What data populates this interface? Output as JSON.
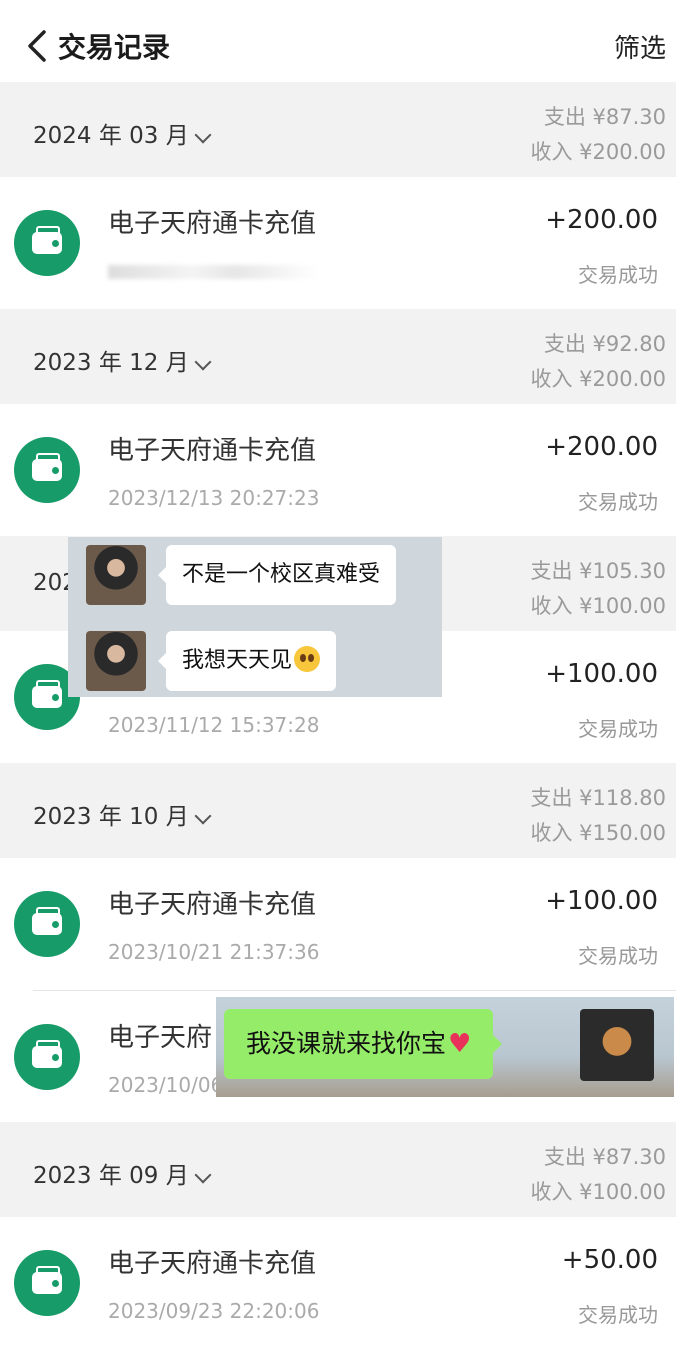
{
  "header": {
    "title": "交易记录",
    "filter_label": "筛选"
  },
  "months": [
    {
      "label": "2024 年 03 月",
      "expense": "支出  ¥87.30",
      "income": "收入  ¥200.00"
    },
    {
      "label": "2023 年 12 月",
      "expense": "支出  ¥92.80",
      "income": "收入  ¥200.00"
    },
    {
      "label": "202",
      "expense": "支出  ¥105.30",
      "income": "收入  ¥100.00"
    },
    {
      "label": "2023 年 10 月",
      "expense": "支出  ¥118.80",
      "income": "收入  ¥150.00"
    },
    {
      "label": "2023 年 09 月",
      "expense": "支出  ¥87.30",
      "income": "收入  ¥100.00"
    }
  ],
  "transactions": [
    {
      "name": "电子天府通卡充值",
      "time": "",
      "amount": "+200.00",
      "status": "交易成功"
    },
    {
      "name": "电子天府通卡充值",
      "time": "2023/12/13 20:27:23",
      "amount": "+200.00",
      "status": "交易成功"
    },
    {
      "name": "",
      "time": "2023/11/12 15:37:28",
      "amount": "+100.00",
      "status": "交易成功"
    },
    {
      "name": "电子天府通卡充值",
      "time": "2023/10/21 21:37:36",
      "amount": "+100.00",
      "status": "交易成功"
    },
    {
      "name": "电子天府",
      "time": "2023/10/06",
      "amount": "",
      "status": ""
    },
    {
      "name": "电子天府通卡充值",
      "time": "2023/09/23 22:20:06",
      "amount": "+50.00",
      "status": "交易成功"
    }
  ],
  "chat_overlays": {
    "message_1": "不是一个校区真难受",
    "message_2": "我想天天见",
    "message_3": "我没课就来找你宝"
  },
  "colors": {
    "accent": "#179b69",
    "chat_green": "#95ec69"
  },
  "icons": {
    "back": "chevron-left-icon",
    "expand": "chevron-down-icon",
    "transaction": "wallet-icon"
  }
}
